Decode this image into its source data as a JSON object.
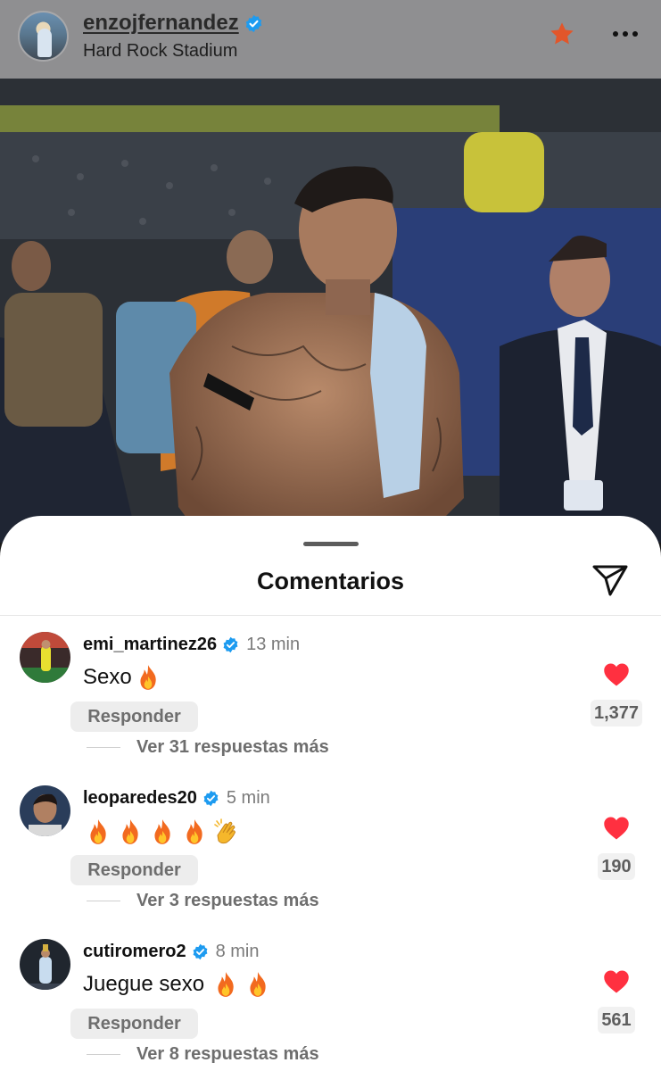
{
  "post": {
    "username": "enzojfernandez",
    "location": "Hard Rock Stadium"
  },
  "comments_sheet": {
    "title": "Comentarios",
    "comments": [
      {
        "username": "emi_martinez26",
        "time": "13 min",
        "text": "Sexo",
        "emojis": [
          "fire"
        ],
        "reply_label": "Responder",
        "view_replies": "Ver 31 respuestas más",
        "likes": "1,377"
      },
      {
        "username": "leoparedes20",
        "time": "5 min",
        "text": "",
        "emojis": [
          "fire",
          "fire",
          "fire",
          "fire",
          "clapping-hands"
        ],
        "reply_label": "Responder",
        "view_replies": "Ver 3 respuestas más",
        "likes": "190"
      },
      {
        "username": "cutiromero2",
        "time": "8 min",
        "text": "Juegue sexo",
        "emojis": [
          "fire",
          "fire"
        ],
        "reply_label": "Responder",
        "view_replies": "Ver 8 respuestas más",
        "likes": "561"
      }
    ]
  },
  "icons": {
    "verified": "verified-badge-icon",
    "favorite": "star-icon",
    "more": "more-options-icon",
    "share": "paper-plane-icon",
    "like": "heart-icon"
  },
  "colors": {
    "verified_blue": "#1d9bf0",
    "heart_red": "#ff3040",
    "star_orange": "#e2562a"
  }
}
